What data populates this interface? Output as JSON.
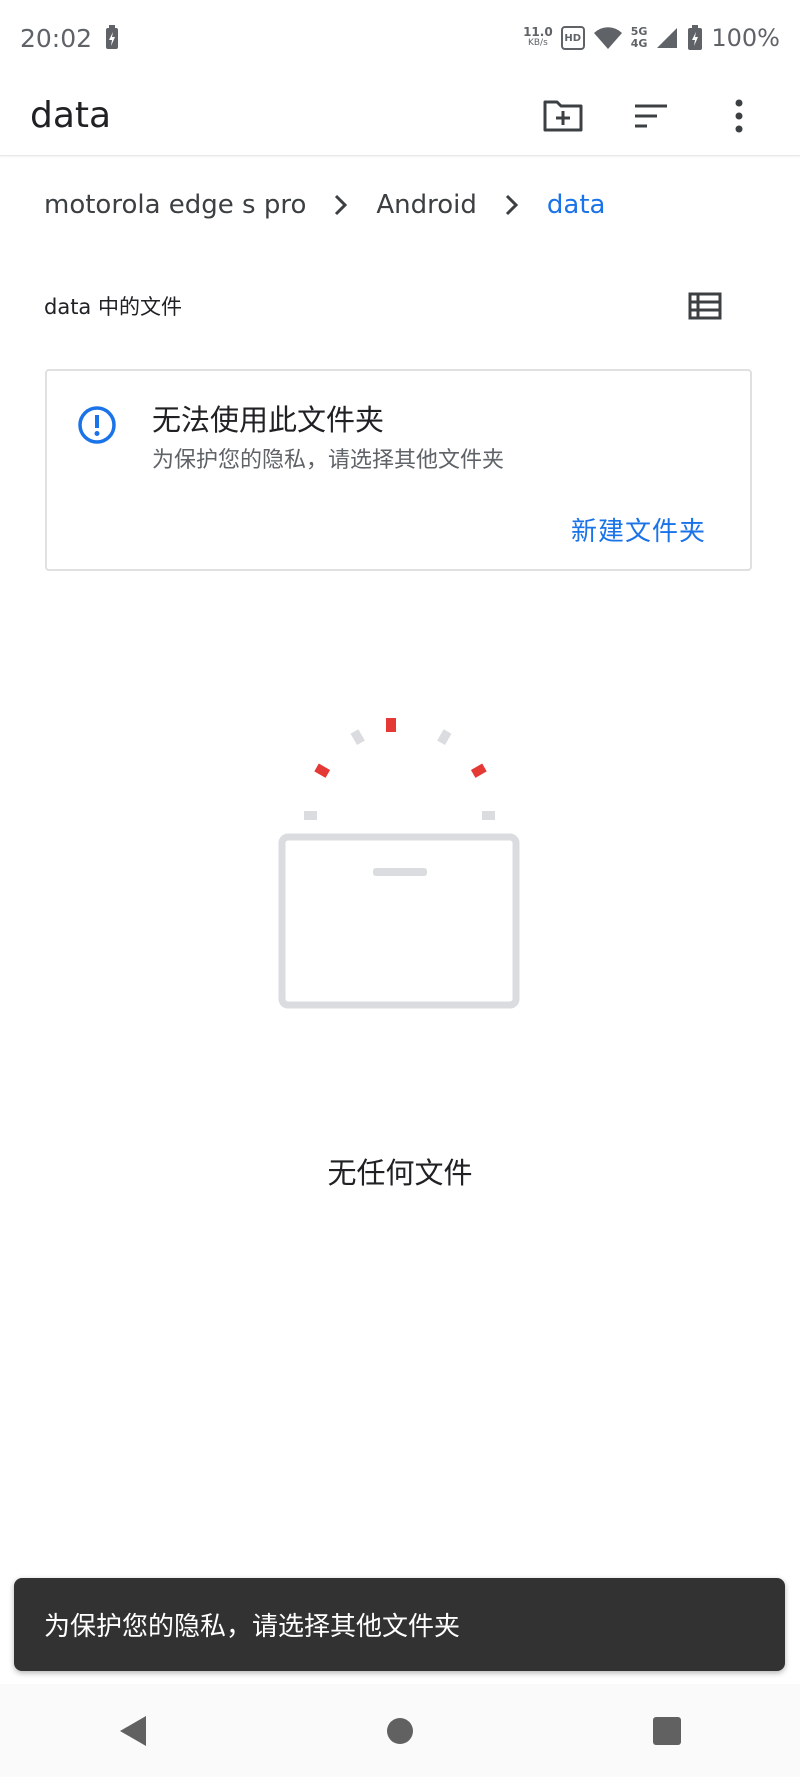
{
  "status_bar": {
    "time": "20:02",
    "net_speed_value": "11.0",
    "net_speed_unit": "KB/s",
    "hd_label": "HD",
    "network_5g": "5G",
    "network_4g": "4G",
    "battery": "100%",
    "icons": [
      "battery-saver-icon",
      "hd-icon",
      "wifi-icon",
      "signal-icon",
      "battery-icon"
    ]
  },
  "app_bar": {
    "title": "data",
    "actions": [
      "new-folder-icon",
      "sort-icon",
      "more-options-icon"
    ]
  },
  "breadcrumb": {
    "items": [
      "motorola edge s pro",
      "Android",
      "data"
    ]
  },
  "section": {
    "title": "data 中的文件",
    "view_toggle_icon": "list-view-icon"
  },
  "notice_card": {
    "title": "无法使用此文件夹",
    "subtitle": "为保护您的隐私，请选择其他文件夹",
    "action": "新建文件夹",
    "icon": "info-alert-icon"
  },
  "empty_state": {
    "text": "无任何文件",
    "illustration": "empty-folder-illustration"
  },
  "snackbar": {
    "text": "为保护您的隐私，请选择其他文件夹"
  },
  "colors": {
    "accent": "#1a73e8",
    "illustration_red": "#e53935",
    "illustration_gray": "#dadce0",
    "snackbar_bg": "#323232"
  }
}
